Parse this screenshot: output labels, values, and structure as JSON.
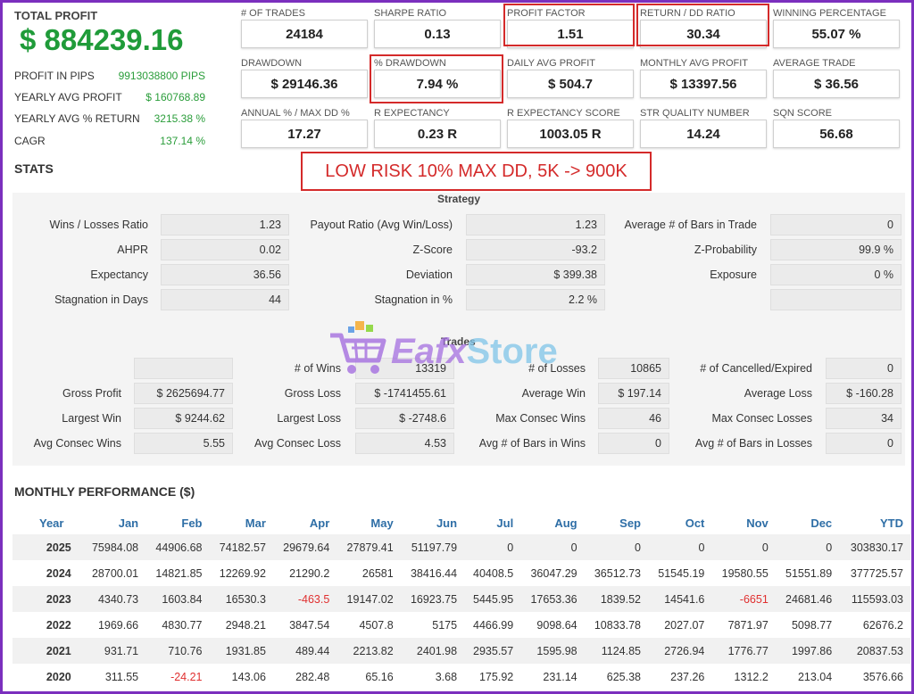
{
  "summary": {
    "total_profit_label": "TOTAL PROFIT",
    "total_profit_value": "$ 884239.16",
    "rows": [
      {
        "label": "PROFIT IN PIPS",
        "value": "9913038800 PIPS"
      },
      {
        "label": "YEARLY AVG PROFIT",
        "value": "$ 160768.89"
      },
      {
        "label": "YEARLY AVG % RETURN",
        "value": "3215.38 %"
      },
      {
        "label": "CAGR",
        "value": "137.14 %"
      }
    ]
  },
  "metrics": [
    {
      "label": "# OF TRADES",
      "value": "24184"
    },
    {
      "label": "SHARPE RATIO",
      "value": "0.13"
    },
    {
      "label": "PROFIT FACTOR",
      "value": "1.51"
    },
    {
      "label": "RETURN / DD RATIO",
      "value": "30.34"
    },
    {
      "label": "WINNING PERCENTAGE",
      "value": "55.07 %"
    },
    {
      "label": "DRAWDOWN",
      "value": "$ 29146.36"
    },
    {
      "label": "% DRAWDOWN",
      "value": "7.94 %"
    },
    {
      "label": "DAILY AVG PROFIT",
      "value": "$ 504.7"
    },
    {
      "label": "MONTHLY AVG PROFIT",
      "value": "$ 13397.56"
    },
    {
      "label": "AVERAGE TRADE",
      "value": "$ 36.56"
    },
    {
      "label": "ANNUAL % / MAX DD %",
      "value": "17.27"
    },
    {
      "label": "R EXPECTANCY",
      "value": "0.23 R"
    },
    {
      "label": "R EXPECTANCY SCORE",
      "value": "1003.05 R"
    },
    {
      "label": "STR QUALITY NUMBER",
      "value": "14.24"
    },
    {
      "label": "SQN SCORE",
      "value": "56.68"
    }
  ],
  "stats_title": "STATS",
  "callout": "LOW RISK 10% MAX DD, 5K -> 900K",
  "strategy": {
    "title": "Strategy",
    "rows": [
      [
        "Wins / Losses Ratio",
        "1.23",
        "Payout Ratio (Avg Win/Loss)",
        "1.23",
        "Average # of Bars in Trade",
        "0"
      ],
      [
        "AHPR",
        "0.02",
        "Z-Score",
        "-93.2",
        "Z-Probability",
        "99.9 %"
      ],
      [
        "Expectancy",
        "36.56",
        "Deviation",
        "$ 399.38",
        "Exposure",
        "0 %"
      ],
      [
        "Stagnation in Days",
        "44",
        "Stagnation in %",
        "2.2 %",
        "",
        ""
      ]
    ]
  },
  "trades": {
    "title": "Trades",
    "rows": [
      [
        "",
        "",
        "# of Wins",
        "13319",
        "# of Losses",
        "10865",
        "# of Cancelled/Expired",
        "0"
      ],
      [
        "Gross Profit",
        "$ 2625694.77",
        "Gross Loss",
        "$ -1741455.61",
        "Average Win",
        "$ 197.14",
        "Average Loss",
        "$ -160.28"
      ],
      [
        "Largest Win",
        "$ 9244.62",
        "Largest Loss",
        "$ -2748.6",
        "Max Consec Wins",
        "46",
        "Max Consec Losses",
        "34"
      ],
      [
        "Avg Consec Wins",
        "5.55",
        "Avg Consec Loss",
        "4.53",
        "Avg # of Bars in Wins",
        "0",
        "Avg # of Bars in Losses",
        "0"
      ]
    ]
  },
  "watermark": {
    "brand_a": "Eafx",
    "brand_b": "Store",
    "icon": "shopping-cart-icon"
  },
  "monthly": {
    "title": "MONTHLY PERFORMANCE ($)",
    "headers": [
      "Year",
      "Jan",
      "Feb",
      "Mar",
      "Apr",
      "May",
      "Jun",
      "Jul",
      "Aug",
      "Sep",
      "Oct",
      "Nov",
      "Dec",
      "YTD"
    ],
    "rows": [
      [
        "2025",
        "75984.08",
        "44906.68",
        "74182.57",
        "29679.64",
        "27879.41",
        "51197.79",
        "0",
        "0",
        "0",
        "0",
        "0",
        "0",
        "303830.17"
      ],
      [
        "2024",
        "28700.01",
        "14821.85",
        "12269.92",
        "21290.2",
        "26581",
        "38416.44",
        "40408.5",
        "36047.29",
        "36512.73",
        "51545.19",
        "19580.55",
        "51551.89",
        "377725.57"
      ],
      [
        "2023",
        "4340.73",
        "1603.84",
        "16530.3",
        "-463.5",
        "19147.02",
        "16923.75",
        "5445.95",
        "17653.36",
        "1839.52",
        "14541.6",
        "-6651",
        "24681.46",
        "115593.03"
      ],
      [
        "2022",
        "1969.66",
        "4830.77",
        "2948.21",
        "3847.54",
        "4507.8",
        "5175",
        "4466.99",
        "9098.64",
        "10833.78",
        "2027.07",
        "7871.97",
        "5098.77",
        "62676.2"
      ],
      [
        "2021",
        "931.71",
        "710.76",
        "1931.85",
        "489.44",
        "2213.82",
        "2401.98",
        "2935.57",
        "1595.98",
        "1124.85",
        "2726.94",
        "1776.77",
        "1997.86",
        "20837.53"
      ],
      [
        "2020",
        "311.55",
        "-24.21",
        "143.06",
        "282.48",
        "65.16",
        "3.68",
        "175.92",
        "231.14",
        "625.38",
        "237.26",
        "1312.2",
        "213.04",
        "3576.66"
      ]
    ]
  },
  "colors": {
    "profit_green": "#1f9b39",
    "highlight_red": "#d42a2a",
    "header_blue": "#2e6ea6",
    "frame_purple": "#7b2fbe"
  }
}
